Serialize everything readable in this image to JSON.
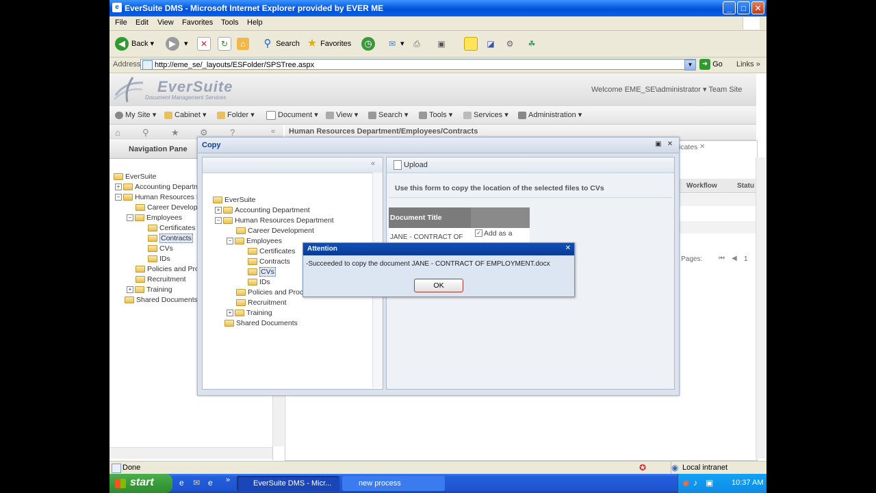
{
  "window": {
    "title": "EverSuite DMS - Microsoft Internet Explorer provided by EVER ME"
  },
  "menu": [
    "File",
    "Edit",
    "View",
    "Favorites",
    "Tools",
    "Help"
  ],
  "toolbar": {
    "back": "Back",
    "search": "Search",
    "favorites": "Favorites"
  },
  "address": {
    "label": "Address",
    "url": "http://eme_se/_layouts/ESFolder/SPSTree.aspx",
    "go": "Go",
    "links": "Links"
  },
  "app": {
    "logo": "EverSuite",
    "logo_sub": "Document Management Services",
    "welcome": "Welcome EME_SE\\administrator ▾  Team Site",
    "main_menu": [
      "My Site ▾",
      "Cabinet ▾",
      "Folder ▾",
      "Document ▾",
      "View ▾",
      "Search ▾",
      "Tools ▾",
      "Services ▾",
      "Administration ▾"
    ],
    "nav_pane": "Navigation Pane",
    "breadcrumb": "Human Resources Department/Employees/Contracts",
    "tab_fragment": "icates",
    "col_workflow": "Workflow",
    "col_status": "Statu",
    "pager": "- Pages:",
    "pager_num": "1"
  },
  "tree": {
    "root": "EverSuite",
    "items": [
      "Accounting Department",
      "Human Resources Department",
      "Career Development",
      "Employees",
      "Certificates",
      "Contracts",
      "CVs",
      "IDs",
      "Policies and Procedures",
      "Recruitment",
      "Training",
      "Shared Documents"
    ]
  },
  "left_tree_truncated": [
    "Accounting Departm",
    "Human Resources D",
    "Career Develop",
    "Certificates",
    "Policies and Pro",
    "Shared Documents"
  ],
  "copy_dialog": {
    "title": "Copy",
    "upload": "Upload",
    "instruction": "Use this form to copy the location of the selected files to CVs",
    "col_doc_title": "Document Title",
    "row_doc_title": "JANE - CONTRACT OF",
    "row_add_as": "Add as a",
    "tree_policies": "Policies and Proce"
  },
  "attention": {
    "title": "Attention",
    "message": "-Succeeded to copy the document JANE - CONTRACT OF EMPLOYMENT.docx",
    "ok": "OK"
  },
  "status": {
    "left": "Done",
    "zone": "Local intranet"
  },
  "taskbar": {
    "start": "start",
    "task1": "EverSuite DMS - Micr...",
    "task2": "new process",
    "clock": "10:37 AM"
  }
}
